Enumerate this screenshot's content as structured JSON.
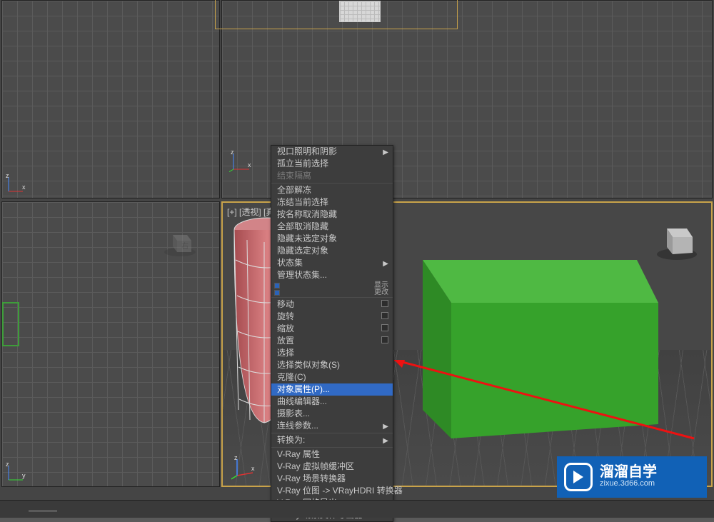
{
  "viewport_label": "[+] [透视] [真",
  "menu": {
    "items": [
      {
        "label": "视口照明和阴影",
        "submenu": true
      },
      {
        "label": "孤立当前选择"
      },
      {
        "label": "结束隔离",
        "disabled": true
      },
      {
        "sep": true
      },
      {
        "label": "全部解冻"
      },
      {
        "label": "冻结当前选择"
      },
      {
        "label": "按名称取消隐藏"
      },
      {
        "label": "全部取消隐藏"
      },
      {
        "label": "隐藏未选定对象"
      },
      {
        "label": "隐藏选定对象"
      },
      {
        "label": "状态集",
        "submenu": true
      },
      {
        "label": "管理状态集..."
      },
      {
        "colortags": true,
        "right": "显示"
      },
      {
        "colortags": true,
        "right": "更改"
      },
      {
        "sep": true
      },
      {
        "label": "移动",
        "check": true
      },
      {
        "label": "旋转",
        "check": true
      },
      {
        "label": "缩放",
        "check": true
      },
      {
        "label": "放置",
        "check": true
      },
      {
        "label": "选择"
      },
      {
        "label": "选择类似对象(S)"
      },
      {
        "label": "克隆(C)"
      },
      {
        "label": "对象属性(P)...",
        "hl": true
      },
      {
        "label": "曲线编辑器..."
      },
      {
        "label": "摄影表..."
      },
      {
        "label": "连线参数...",
        "submenu": true
      },
      {
        "sep": true
      },
      {
        "label": "转换为:",
        "submenu": true
      },
      {
        "sep": true
      },
      {
        "label": "V-Ray 属性"
      },
      {
        "label": "V-Ray 虚拟帧缓冲区"
      },
      {
        "label": "V-Ray 场景转换器"
      },
      {
        "label": "V-Ray 位图 -> VRayHDRI 转换器"
      },
      {
        "label": "V-Ray 网格导出"
      },
      {
        "label": "V-Ray 场景文件导出器"
      }
    ]
  },
  "watermark": {
    "title": "溜溜自学",
    "sub": "zixue.3d66.com"
  }
}
